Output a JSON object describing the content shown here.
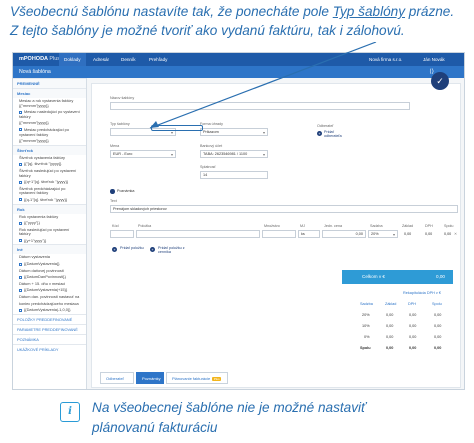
{
  "caption_top": {
    "line1_pre": "Všeobecnú šablónu nastavíte tak, že ponecháte pole ",
    "line1_link": "Typ šablóny",
    "line1_post": " prázne.",
    "line2": "Z tejto šablóny je možné tvoriť ako vydanú faktúru, tak i zálohovú."
  },
  "caption_bottom": {
    "line1": "Na všeobecnej šablóne nie je možné nastaviť",
    "line2": "plánovanú fakturáciu"
  },
  "app": {
    "logo": "mPOHODA",
    "logo_suffix": "Plus",
    "nav": [
      "Doklady",
      "Adresár",
      "Denník",
      "Prehľady"
    ],
    "user": "Nová firma s.r.o.",
    "user2": "Ján Novák",
    "window_title": "Nová šablóna"
  },
  "sidebar": {
    "groups": [
      {
        "label": "PREMENNÉ",
        "items": []
      },
      {
        "label": "Mesiac",
        "items": [
          "Mesiac a rok vystavenia faktúry {{\"mmmm\"|yyyy}}",
          "Mesiac nasledujúci po vystavení faktúry",
          "{{\"mmmm\"|yyyy}}",
          "Mesiac predchádzajúci po vystavení faktúry",
          "{{\"mmmm\"|yyyy}}"
        ]
      },
      {
        "label": "Štvrťrok",
        "items": [
          "Štvrťrok vystavenia faktúry",
          "{{\"[q]. štvrťrok \"|yyyy}}",
          "Štvrťrok nasledujúci po vystavení faktúry",
          "{{q+1\"[q]. štvrťrok \"|yyyy}}",
          "Štvrťrok predchádzajúci po vystavení faktúry",
          "{{q-1\"[q]. štvrťrok \"|yyyy}}"
        ]
      },
      {
        "label": "Rok",
        "items": [
          "Rok vystavenia faktúry",
          "{{\"yyyy\"}}",
          "Rok nasledujúci po vystavení faktúry",
          "{{y+1\"yyyy\"}}"
        ]
      },
      {
        "label": "Iné",
        "items": [
          "Dátum vystavenia",
          "{{DatumVystavenia}}",
          "Dátum daňovej povinnosti",
          "{{DatumDanPovinnosti}}",
          "Dátum + 15. dňu v mesiaci",
          "{{DatumVystavenia|+15}}",
          "Dátum dan. povinnosti nastavuť na",
          "koniec predchádzajúceho mesiaca",
          "{{DatumVystavenia|-1,0,0}}"
        ]
      }
    ],
    "links": [
      "POLOŽKY PREDDEFINOVANÉ",
      "PARAMETRE PREDDEFINOVANÉ",
      "POZNÁMKA",
      "UKÁŽKOVÉ PRÍKLADY"
    ]
  },
  "form": {
    "sablona_label": "Názov šablóny",
    "sablona_value": "",
    "typ_label": "Typ šablóny",
    "typ_value": "",
    "forma_label": "Forma úhrady",
    "forma_value": "Prikazom",
    "mena_label": "Mena",
    "mena_value": "EUR - Euro",
    "ucet_label": "Bankový účet",
    "ucet_value": "TABA: 2623546981 / 1100",
    "splatnost_label": "Splatnosť",
    "splatnost_value": "14",
    "odberatel_label": "Odberateľ",
    "odberatel_btn": "Pridať odberateľa",
    "poznamka": "Poznámka",
    "text_label": "Text",
    "text_value": "Prenájom skladových priestorov",
    "items_headers": [
      "Kód",
      "Položka",
      "Množstvo",
      "MJ",
      "Jedn. cena",
      "Sadzba",
      "Základ",
      "DPH",
      "Spolu"
    ],
    "items_row": {
      "mj": "ks",
      "cena": "0,00",
      "sadzba": "20%",
      "zaklad": "0,00",
      "dph": "0,00",
      "spolu": "0,00"
    },
    "add_item": "Pridať položku",
    "add_item_z": "Pridať položku z cenníka",
    "sum_label": "Celkom v €",
    "sum_value": "0,00",
    "vat_link": "Rekapitulácia DPH v €",
    "vat_headers": [
      "Sadzba",
      "Základ",
      "DPH",
      "Spolu"
    ],
    "vat_rows": [
      [
        "20%",
        "0,00",
        "0,00",
        "0,00"
      ],
      [
        "10%",
        "0,00",
        "0,00",
        "0,00"
      ],
      [
        "0%",
        "0,00",
        "0,00",
        "0,00"
      ],
      [
        "Spolu",
        "0,00",
        "0,00",
        "0,00"
      ]
    ]
  },
  "tabs": [
    {
      "label": "Odberateľ",
      "active": false
    },
    {
      "label": "Poznámky",
      "active": true
    },
    {
      "label": "Plánovanie fakturácie",
      "active": false,
      "badge": "Plus"
    }
  ],
  "icons": {
    "info": "info-icon",
    "check": "check-icon"
  }
}
